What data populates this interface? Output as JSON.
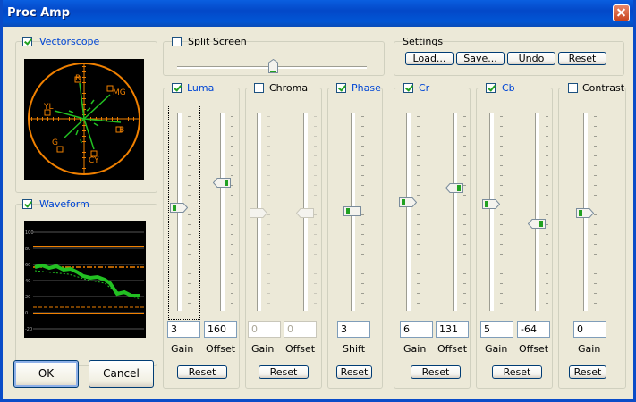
{
  "window": {
    "title": "Proc Amp"
  },
  "vectorscope": {
    "label": "Vectorscope",
    "checked": true,
    "targets": [
      "R",
      "MG",
      "B",
      "CY",
      "G",
      "YL"
    ]
  },
  "waveform": {
    "label": "Waveform",
    "checked": true,
    "scale": [
      "100",
      "80",
      "60",
      "40",
      "20",
      "0",
      "-20"
    ]
  },
  "split_screen": {
    "label": "Split Screen",
    "checked": false
  },
  "settings": {
    "label": "Settings",
    "buttons": [
      "Load...",
      "Save...",
      "Undo",
      "Reset"
    ]
  },
  "luma": {
    "label": "Luma",
    "checked": true,
    "gain": "3",
    "offset": "160",
    "gain_label": "Gain",
    "offset_label": "Offset",
    "reset": "Reset"
  },
  "chroma": {
    "label": "Chroma",
    "checked": false,
    "gain": "0",
    "offset": "0",
    "gain_label": "Gain",
    "offset_label": "Offset",
    "reset": "Reset"
  },
  "phase": {
    "label": "Phase",
    "checked": true,
    "shift": "3",
    "shift_label": "Shift",
    "reset": "Reset"
  },
  "cr": {
    "label": "Cr",
    "checked": true,
    "gain": "6",
    "offset": "131",
    "gain_label": "Gain",
    "offset_label": "Offset",
    "reset": "Reset"
  },
  "cb": {
    "label": "Cb",
    "checked": true,
    "gain": "5",
    "offset": "-64",
    "gain_label": "Gain",
    "offset_label": "Offset",
    "reset": "Reset"
  },
  "contrast": {
    "label": "Contrast",
    "checked": false,
    "gain": "0",
    "gain_label": "Gain",
    "reset": "Reset"
  },
  "footer": {
    "ok": "OK",
    "cancel": "Cancel"
  },
  "colors": {
    "accent": "#F08000",
    "trace": "#22C022",
    "scope_bg": "#000000",
    "title_bar": "#0A5FE0"
  }
}
